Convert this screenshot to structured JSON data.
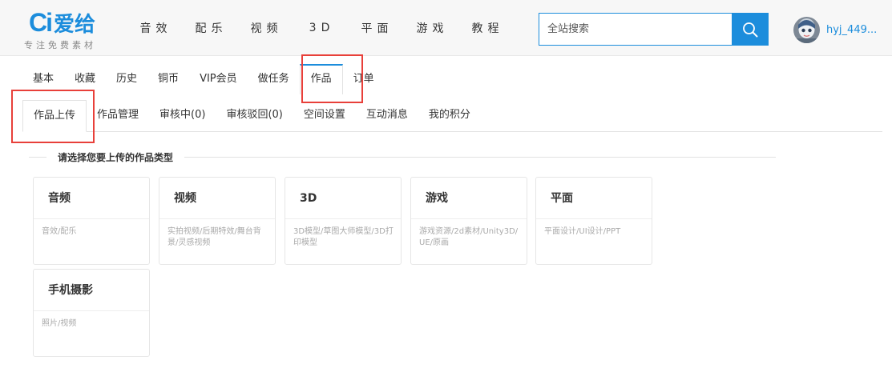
{
  "brand": {
    "logo_mark": "Ci",
    "logo_name": "爱给",
    "slogan": "专注免费素材",
    "color": "#1c8ddc"
  },
  "nav": {
    "items": [
      {
        "label": "音效"
      },
      {
        "label": "配乐"
      },
      {
        "label": "视频"
      },
      {
        "label": "3D"
      },
      {
        "label": "平面"
      },
      {
        "label": "游戏"
      },
      {
        "label": "教程"
      }
    ]
  },
  "search": {
    "placeholder": "全站搜索",
    "value": "",
    "icon": "search-icon"
  },
  "user": {
    "name": "hyj_449...",
    "avatar_icon": "avatar-icon"
  },
  "tabs": {
    "items": [
      {
        "label": "基本"
      },
      {
        "label": "收藏"
      },
      {
        "label": "历史"
      },
      {
        "label": "铜币"
      },
      {
        "label": "VIP会员"
      },
      {
        "label": "做任务"
      },
      {
        "label": "作品"
      },
      {
        "label": "订单"
      }
    ],
    "active": "作品"
  },
  "subtabs": {
    "items": [
      {
        "label": "作品上传"
      },
      {
        "label": "作品管理"
      },
      {
        "label": "审核中(0)"
      },
      {
        "label": "审核驳回(0)"
      },
      {
        "label": "空间设置"
      },
      {
        "label": "互动消息"
      },
      {
        "label": "我的积分"
      }
    ],
    "active": "作品上传"
  },
  "section": {
    "title": "请选择您要上传的作品类型"
  },
  "categories": [
    {
      "title": "音频",
      "desc": "音效/配乐"
    },
    {
      "title": "视频",
      "desc": "实拍视频/后期特效/舞台背景/灵感视频"
    },
    {
      "title": "3D",
      "desc": "3D模型/草图大师模型/3D打印模型"
    },
    {
      "title": "游戏",
      "desc": "游戏资源/2d素材/Unity3D/UE/原画"
    },
    {
      "title": "平面",
      "desc": "平面设计/UI设计/PPT"
    },
    {
      "title": "手机摄影",
      "desc": "照片/视频"
    }
  ],
  "colors": {
    "accent": "#1c8ddc",
    "highlight": "#e8403a"
  }
}
